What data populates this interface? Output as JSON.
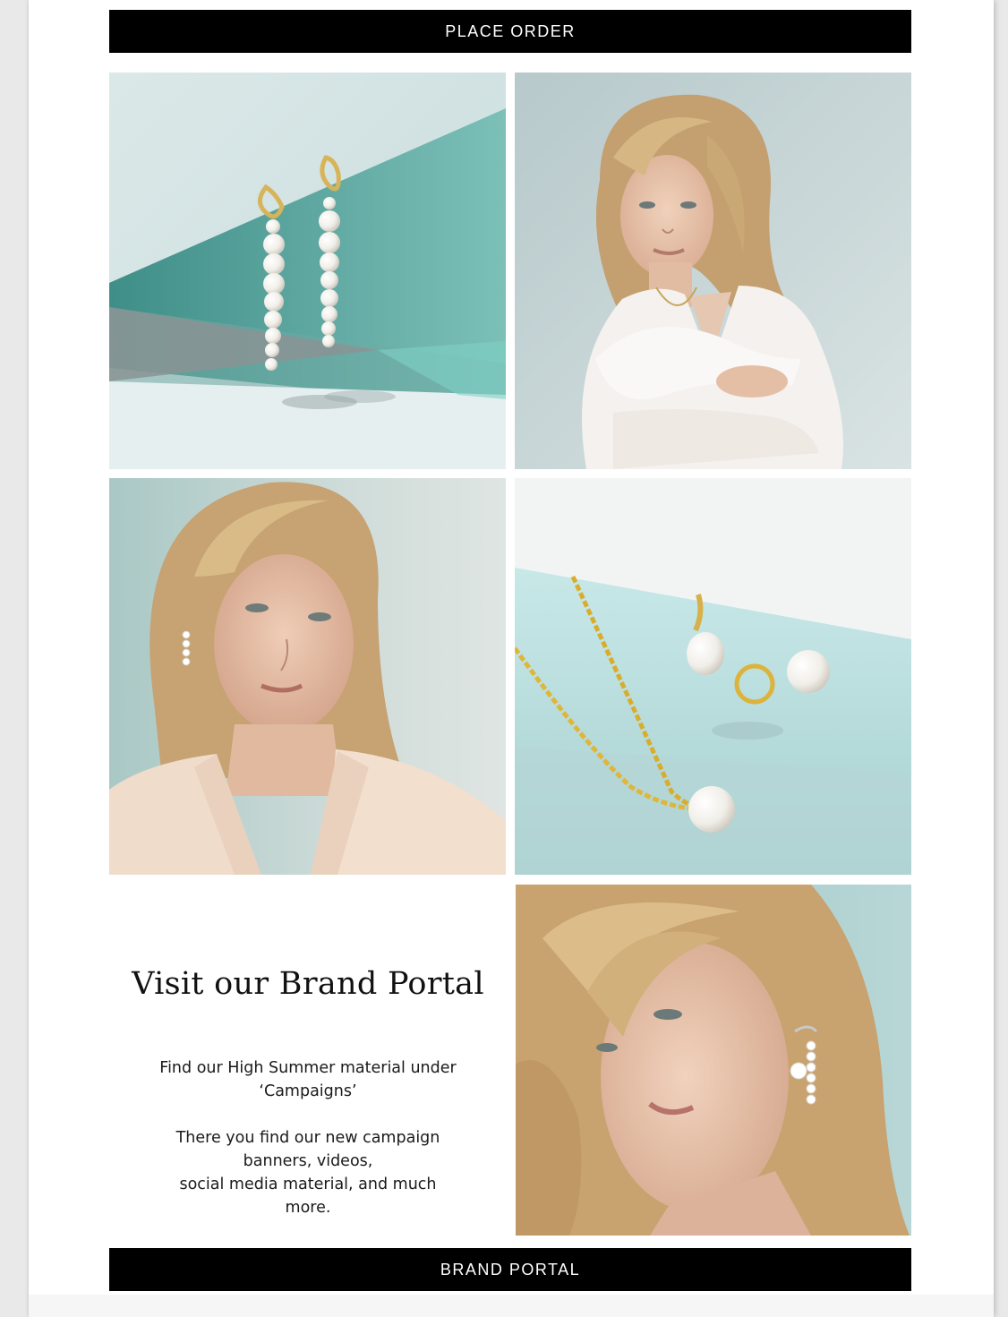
{
  "buttons": {
    "place_order": "PLACE ORDER",
    "brand_portal": "BRAND PORTAL"
  },
  "promo": {
    "headline": "Visit our Brand Portal",
    "line1": "Find our High Summer material under",
    "line2": "‘Campaigns’",
    "line3": "There you find our new campaign",
    "line4": "banners, videos,",
    "line5": "social media material, and much",
    "line6": "more."
  },
  "images": [
    {
      "name": "pearl-drop-earrings-photo"
    },
    {
      "name": "model-white-shirt-photo"
    },
    {
      "name": "model-beige-blazer-photo"
    },
    {
      "name": "gold-chain-pearl-pendant-photo"
    },
    {
      "name": "model-pearl-earring-closeup-photo"
    }
  ],
  "colors": {
    "button_bg": "#000000",
    "button_text": "#ffffff",
    "accent_teal": "#6fb3ac",
    "skin": "#e8c3a8",
    "hair": "#c9a77a"
  }
}
